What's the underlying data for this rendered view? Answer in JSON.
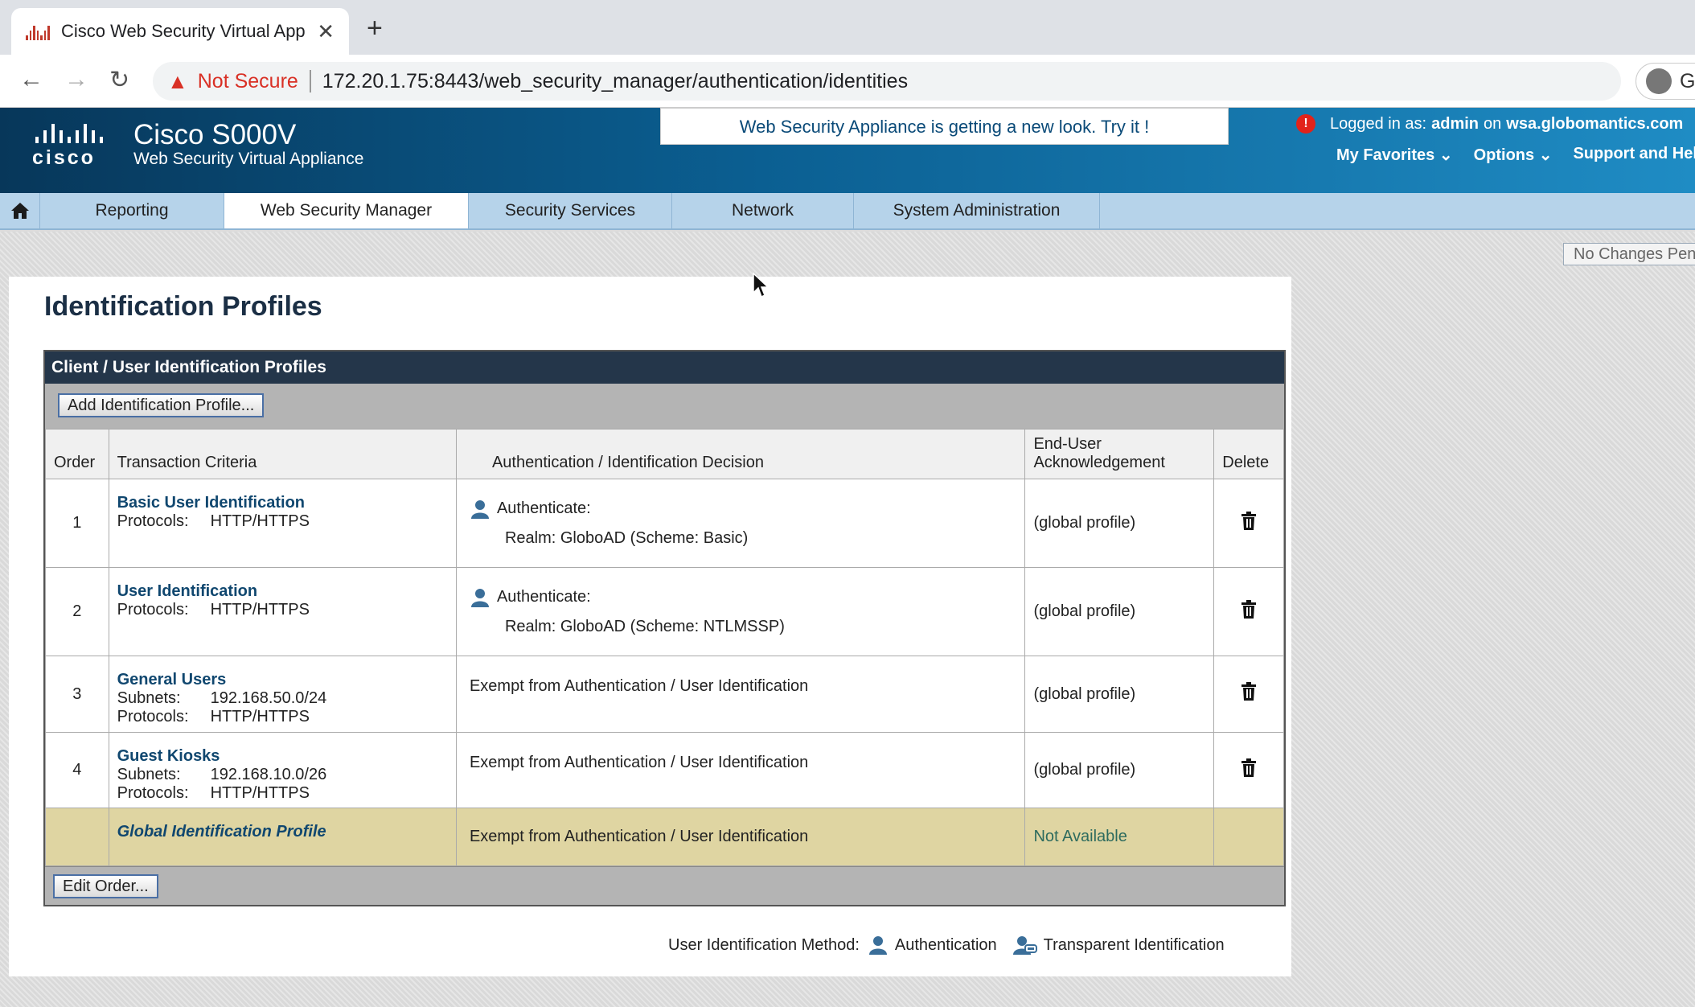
{
  "browser": {
    "tab_title": "Cisco Web Security Virtual App",
    "close": "✕",
    "new_tab": "+",
    "not_secure": "Not Secure",
    "url": "172.20.1.75:8443/web_security_manager/authentication/identities",
    "profile_initial": "Gu"
  },
  "header": {
    "brand": "cisco",
    "product_name": "Cisco S000V",
    "product_sub": "Web Security Virtual Appliance",
    "new_look": "Web Security Appliance is getting a new look. Try it !",
    "logged_in_label": "Logged in as:",
    "user": "admin",
    "on": "on",
    "host": "wsa.globomantics.com",
    "links": [
      "My Favorites ⌄",
      "Options ⌄",
      "Support and Help"
    ]
  },
  "nav": {
    "items": [
      "Reporting",
      "Web Security Manager",
      "Security Services",
      "Network",
      "System Administration"
    ],
    "active": "Web Security Manager"
  },
  "status": {
    "no_changes": "No Changes Pending"
  },
  "page": {
    "title": "Identification Profiles",
    "section_title": "Client / User Identification Profiles",
    "add_button": "Add Identification Profile...",
    "edit_order_button": "Edit Order...",
    "columns": {
      "order": "Order",
      "criteria": "Transaction Criteria",
      "decision": "Authentication / Identification Decision",
      "ack_line1": "End-User",
      "ack_line2": "Acknowledgement",
      "delete": "Delete"
    },
    "rows": [
      {
        "order": "1",
        "name": "Basic User Identification",
        "protocols_label": "Protocols:",
        "protocols": "HTTP/HTTPS",
        "decision_label": "Authenticate:",
        "realm": "Realm: GloboAD (Scheme: Basic)",
        "ack": "(global profile)"
      },
      {
        "order": "2",
        "name": "User Identification",
        "protocols_label": "Protocols:",
        "protocols": "HTTP/HTTPS",
        "decision_label": "Authenticate:",
        "realm": "Realm: GloboAD (Scheme: NTLMSSP)",
        "ack": "(global profile)"
      },
      {
        "order": "3",
        "name": "General Users",
        "subnets_label": "Subnets:",
        "subnets": "192.168.50.0/24",
        "protocols_label": "Protocols:",
        "protocols": "HTTP/HTTPS",
        "decision": "Exempt from Authentication / User Identification",
        "ack": "(global profile)"
      },
      {
        "order": "4",
        "name": "Guest Kiosks",
        "subnets_label": "Subnets:",
        "subnets": "192.168.10.0/26",
        "protocols_label": "Protocols:",
        "protocols": "HTTP/HTTPS",
        "decision": "Exempt from Authentication / User Identification",
        "ack": "(global profile)"
      }
    ],
    "global_row": {
      "name": "Global Identification Profile",
      "decision": "Exempt from Authentication / User Identification",
      "ack": "Not Available"
    },
    "legend": {
      "label": "User Identification Method:",
      "auth": "Authentication",
      "transparent": "Transparent Identification"
    }
  },
  "icons": {
    "user": "user-icon",
    "transparent": "transparent-user-icon",
    "trash": "trash-icon",
    "home": "home-icon"
  },
  "colors": {
    "header_dark": "#07375a",
    "header_light": "#1f8cc4",
    "nav": "#b6d3ea",
    "table_head": "#24364a",
    "global_row": "#dfd5a2",
    "link": "#10476f"
  }
}
